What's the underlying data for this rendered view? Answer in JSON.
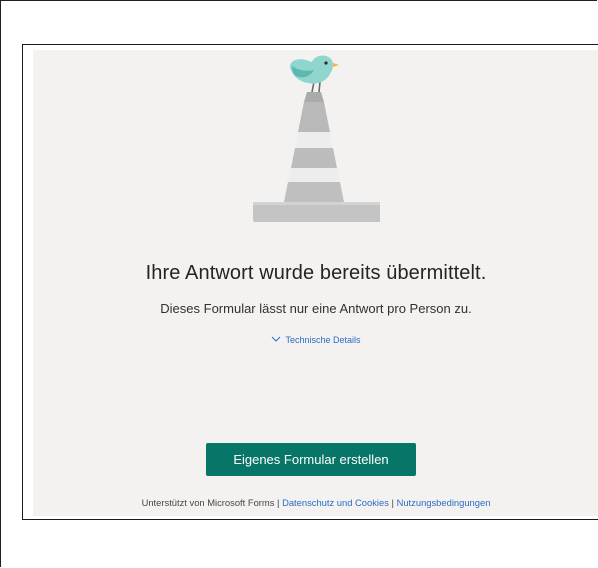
{
  "message": {
    "heading": "Ihre Antwort wurde bereits übermittelt.",
    "subtext": "Dieses Formular lässt nur eine Antwort pro Person zu.",
    "details_link": "Technische Details"
  },
  "actions": {
    "create_button_label": "Eigenes Formular erstellen",
    "button_color": "#077568"
  },
  "footer": {
    "powered_by": "Unterstützt von Microsoft Forms",
    "separator": " | ",
    "privacy_link": "Datenschutz und Cookies",
    "terms_link": "Nutzungsbedingungen"
  },
  "illustration": {
    "icon": "bird-on-traffic-cone-icon",
    "bird_color": "#7fcfc7",
    "cone_color": "#bdbdbd"
  },
  "colors": {
    "page_background": "#f3f2f1",
    "link": "#2b6cc4"
  }
}
